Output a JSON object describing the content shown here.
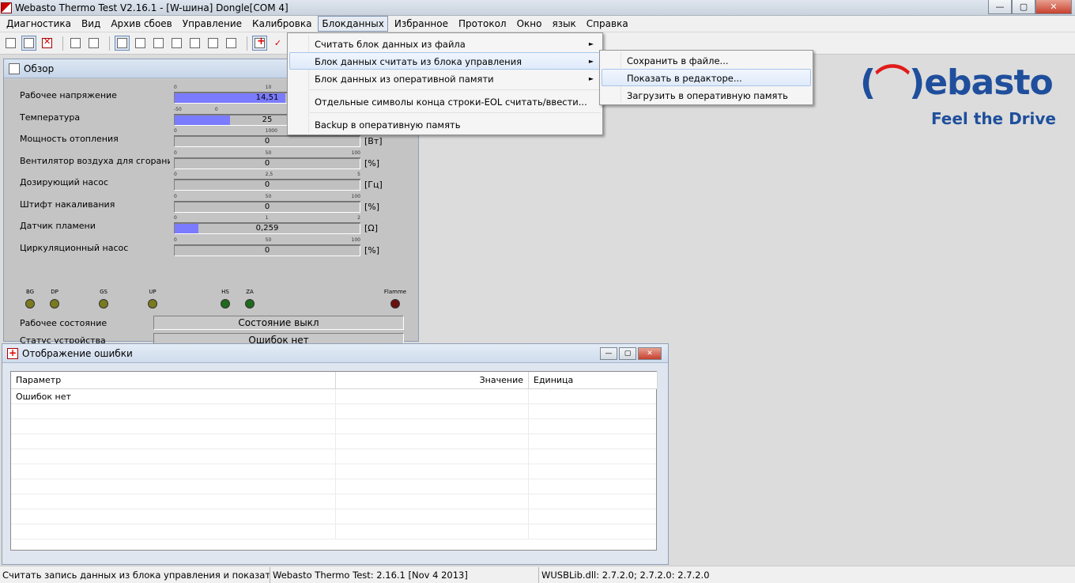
{
  "window": {
    "title": "Webasto Thermo Test V2.16.1 - [W-шина] Dongle[COM 4]",
    "minimize": "—",
    "maximize": "▢",
    "close": "✕"
  },
  "menubar": {
    "items": [
      "Диагностика",
      "Вид",
      "Архив сбоев",
      "Управление",
      "Калибровка",
      "Блокданных",
      "Избранное",
      "Протокол",
      "Окно",
      "язык",
      "Справка"
    ],
    "open_item": "Блокданных"
  },
  "blockdata_menu": {
    "items": [
      {
        "label": "Считать блок данных из файла",
        "arrow": "►"
      },
      {
        "label": "Блок данных считать из блока управления",
        "arrow": "►"
      },
      {
        "label": "Блок данных из оперативной памяти",
        "arrow": "►"
      },
      {
        "label": "Отдельные символы конца строки-EOL считать/ввести..."
      },
      {
        "label": "Backup в оперативную память"
      }
    ]
  },
  "submenu": {
    "items": [
      {
        "label": "Сохранить в файле..."
      },
      {
        "label": "Показать в редакторе..."
      },
      {
        "label": "Загрузить в оперативную память"
      }
    ]
  },
  "overview": {
    "title": "Обзор",
    "rows": [
      {
        "label": "Рабочее напряжение",
        "value": "14,51",
        "unit": "",
        "scale": [
          "0",
          "",
          "10",
          ""
        ],
        "fill": 0.6
      },
      {
        "label": "Температура",
        "value": "25",
        "unit": "",
        "scale": [
          "-50",
          "0",
          "",
          ""
        ],
        "fill": 0.3
      },
      {
        "label": "Мощность отопления",
        "value": "0",
        "unit": "[Вт]",
        "scale": [
          "0",
          "",
          "1000",
          ""
        ],
        "fill": 0
      },
      {
        "label": "Вентилятор воздуха для сгорания топлива",
        "value": "0",
        "unit": "[%]",
        "scale": [
          "0",
          "",
          "50",
          "100"
        ],
        "fill": 0
      },
      {
        "label": "Дозирующий насос",
        "value": "0",
        "unit": "[Гц]",
        "scale": [
          "0",
          "",
          "2,5",
          "5"
        ],
        "fill": 0
      },
      {
        "label": "Штифт накаливания",
        "value": "0",
        "unit": "[%]",
        "scale": [
          "0",
          "",
          "50",
          "100"
        ],
        "fill": 0
      },
      {
        "label": "Датчик пламени",
        "value": "0,259",
        "unit": "[Ω]",
        "scale": [
          "0",
          "",
          "1",
          "2"
        ],
        "fill": 0.13
      },
      {
        "label": "Циркуляционный насос",
        "value": "0",
        "unit": "[%]",
        "scale": [
          "0",
          "",
          "50",
          "100"
        ],
        "fill": 0
      }
    ],
    "leds": [
      {
        "label": "BG",
        "color": "#7a7a1e"
      },
      {
        "label": "DP",
        "color": "#7a7a1e"
      },
      {
        "label": "GS",
        "color": "#7a7a1e"
      },
      {
        "label": "UP",
        "color": "#7a7a1e"
      },
      {
        "label": "HS",
        "color": "#1e6a1e"
      },
      {
        "label": "ZA",
        "color": "#1e6a1e"
      },
      {
        "label": "Flamme",
        "color": "#6a1010"
      }
    ],
    "operating_state_label": "Рабочее состояние",
    "operating_state_value": "Состояние выкл",
    "device_status_label": "Статус устройства",
    "device_status_value": "Ошибок нет"
  },
  "error_window": {
    "title": "Отображение ошибки",
    "columns": [
      "Параметр",
      "Значение",
      "Единица"
    ],
    "rows": [
      [
        "Ошибок нет",
        "",
        ""
      ]
    ]
  },
  "logo": {
    "word": "ebasto",
    "tagline": "Feel the Drive",
    "brand_color": "#1f4f9c",
    "accent_color": "#e21b1b"
  },
  "statusbar": {
    "message": "Считать запись данных из блока управления и показать в ред",
    "version": "Webasto Thermo Test: 2.16.1 [Nov  4 2013]",
    "dll": "WUSBLib.dll: 2.7.2.0; 2.7.2.0: 2.7.2.0"
  }
}
